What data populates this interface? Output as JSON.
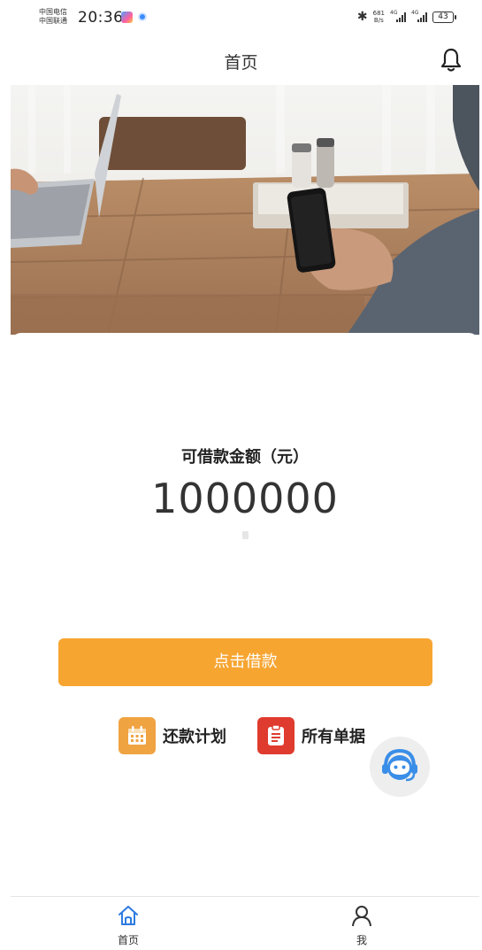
{
  "status_bar": {
    "carrier_1": "中国电信",
    "carrier_2": "中国联通",
    "time": "20:36",
    "net_speed_value": "681",
    "net_speed_unit": "B/s",
    "signal_tag_1": "4G",
    "signal_tag_2": "4G",
    "battery": "43"
  },
  "nav": {
    "title": "首页",
    "bell_icon": "bell-icon"
  },
  "banner": {
    "image": "desk-laptop-phone-photo"
  },
  "loan": {
    "amount_label": "可借款金额（元）",
    "amount_value": "1000000",
    "button_label": "点击借款"
  },
  "quick_links": [
    {
      "label": "还款计划",
      "icon": "calendar-icon",
      "color": "#f0a341"
    },
    {
      "label": "所有单据",
      "icon": "clipboard-icon",
      "color": "#df3b2e"
    }
  ],
  "service": {
    "icon": "customer-service-icon",
    "color": "#3a8ee8"
  },
  "tab_bar": {
    "items": [
      {
        "label": "首页",
        "icon": "home-icon",
        "active": true,
        "color": "#2e7be0"
      },
      {
        "label": "我",
        "icon": "user-icon",
        "active": false,
        "color": "#333333"
      }
    ]
  },
  "colors": {
    "accent": "#f7a531",
    "background": "#ffffff"
  }
}
